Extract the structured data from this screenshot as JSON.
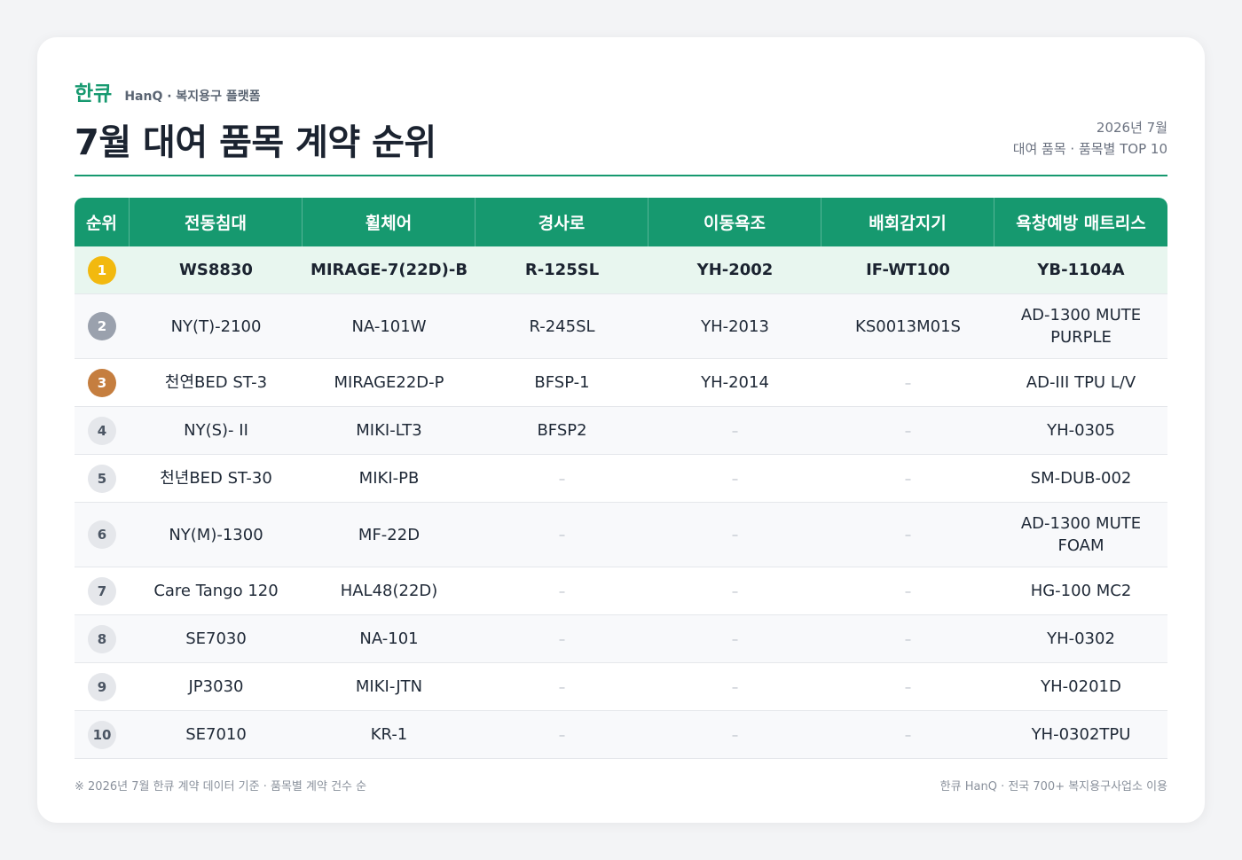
{
  "header": {
    "logo": "한큐",
    "subtitle": "HanQ · 복지용구 플랫폼",
    "title": "7월 대여 품목 계약 순위",
    "date": "2026년 7월",
    "scope": "대여 품목 · 품목별 TOP 10"
  },
  "colors": {
    "brand_green": "#16996f",
    "gold": "#f2b90f",
    "silver": "#9aa1ad",
    "bronze": "#c57e3f",
    "top_row_bg": "#e8f6ef"
  },
  "table": {
    "columns": [
      "순위",
      "전동침대",
      "휠체어",
      "경사로",
      "이동욕조",
      "배회감지기",
      "욕창예방 매트리스"
    ],
    "rows": [
      {
        "rank": "1",
        "cells": [
          "WS8830",
          "MIRAGE-7(22D)-B",
          "R-125SL",
          "YH-2002",
          "IF-WT100",
          "YB-1104A"
        ]
      },
      {
        "rank": "2",
        "cells": [
          "NY(T)-2100",
          "NA-101W",
          "R-245SL",
          "YH-2013",
          "KS0013M01S",
          "AD-1300 MUTE PURPLE"
        ]
      },
      {
        "rank": "3",
        "cells": [
          "천연BED ST-3",
          "MIRAGE22D-P",
          "BFSP-1",
          "YH-2014",
          "–",
          "AD-III TPU L/V"
        ]
      },
      {
        "rank": "4",
        "cells": [
          "NY(S)- II",
          "MIKI-LT3",
          "BFSP2",
          "–",
          "–",
          "YH-0305"
        ]
      },
      {
        "rank": "5",
        "cells": [
          "천년BED ST-30",
          "MIKI-PB",
          "–",
          "–",
          "–",
          "SM-DUB-002"
        ]
      },
      {
        "rank": "6",
        "cells": [
          "NY(M)-1300",
          "MF-22D",
          "–",
          "–",
          "–",
          "AD-1300 MUTE FOAM"
        ]
      },
      {
        "rank": "7",
        "cells": [
          "Care Tango 120",
          "HAL48(22D)",
          "–",
          "–",
          "–",
          "HG-100 MC2"
        ]
      },
      {
        "rank": "8",
        "cells": [
          "SE7030",
          "NA-101",
          "–",
          "–",
          "–",
          "YH-0302"
        ]
      },
      {
        "rank": "9",
        "cells": [
          "JP3030",
          "MIKI-JTN",
          "–",
          "–",
          "–",
          "YH-0201D"
        ]
      },
      {
        "rank": "10",
        "cells": [
          "SE7010",
          "KR-1",
          "–",
          "–",
          "–",
          "YH-0302TPU"
        ]
      }
    ]
  },
  "footer": {
    "note": "※ 2026년 7월 한큐 계약 데이터 기준 · 품목별 계약 건수 순",
    "credit": "한큐 HanQ · 전국 700+ 복지용구사업소 이용"
  }
}
